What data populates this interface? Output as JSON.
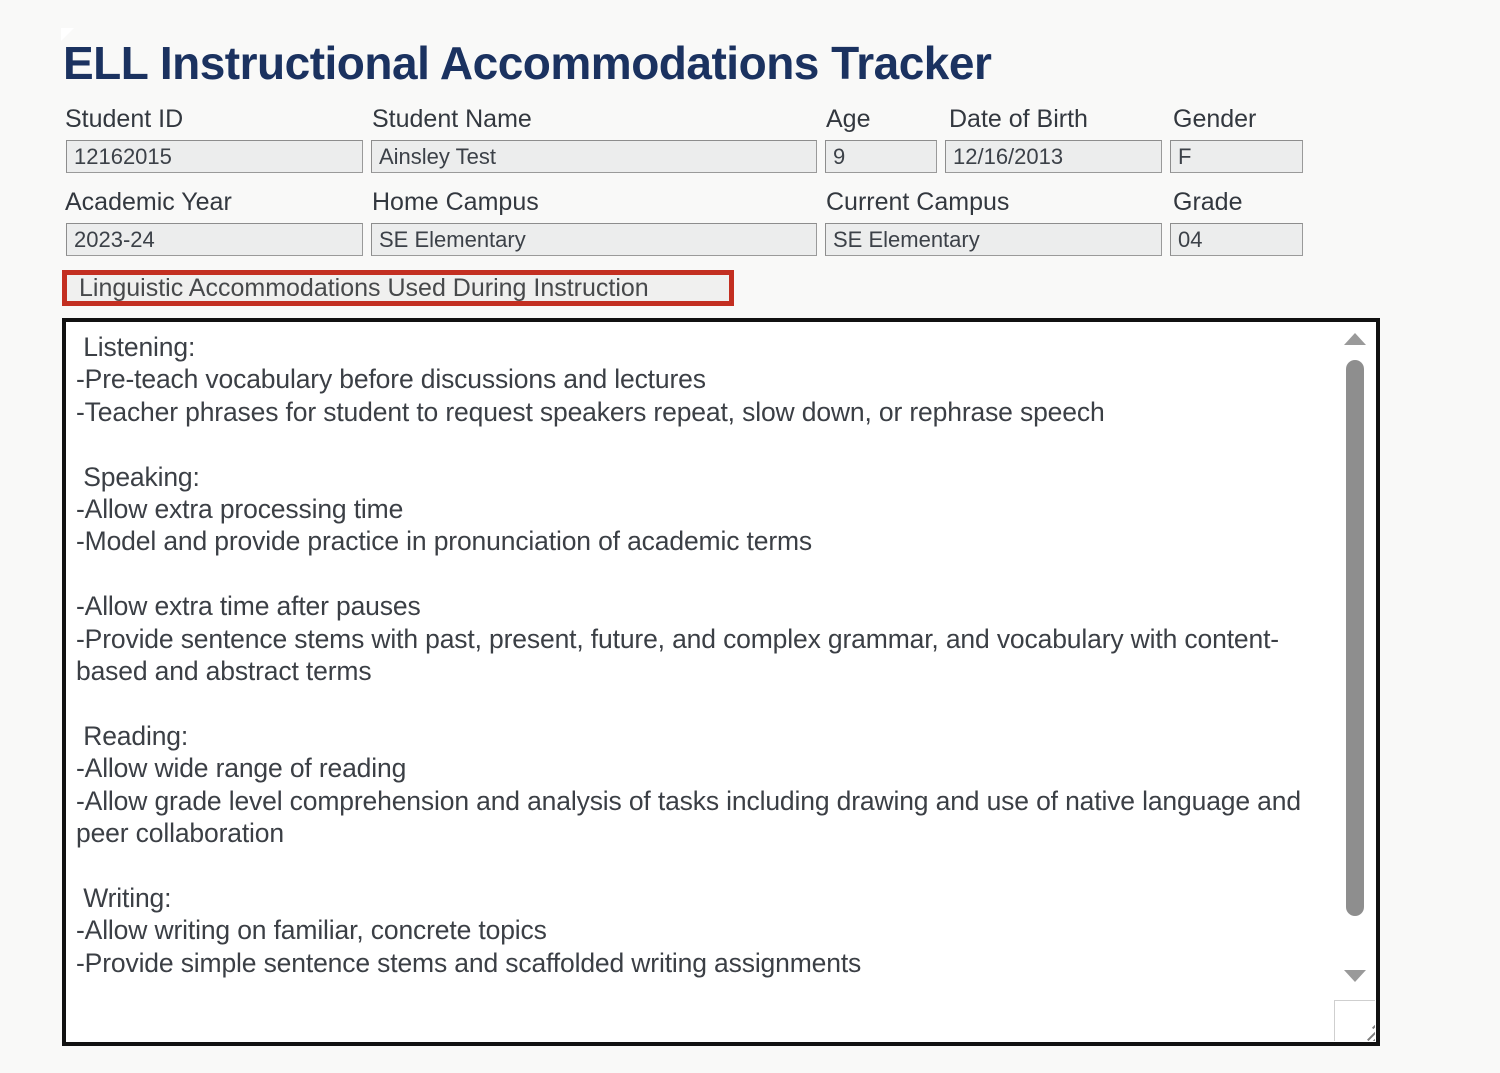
{
  "document": {
    "title": "ELL Instructional Accommodations Tracker",
    "accent_red": "#c32f21",
    "title_color": "#1b3260",
    "page_background": "#f9f9f8"
  },
  "student_info": {
    "fields": [
      {
        "label": "Student ID",
        "value": "12162015"
      },
      {
        "label": "Student Name",
        "value": "Ainsley Test"
      },
      {
        "label": "Age",
        "value": "9"
      },
      {
        "label": "Date of Birth",
        "value": "12/16/2013"
      },
      {
        "label": "Gender",
        "value": "F"
      },
      {
        "label": "Academic Year",
        "value": "2023-24"
      },
      {
        "label": "Home Campus",
        "value": "SE Elementary"
      },
      {
        "label": "Current Campus",
        "value": "SE Elementary"
      },
      {
        "label": "Grade",
        "value": "04"
      }
    ]
  },
  "section": {
    "header": "Linguistic Accommodations Used During Instruction"
  },
  "accommodations": {
    "lines": [
      " Listening:",
      "-Pre-teach vocabulary before discussions and lectures",
      "-Teacher phrases for student to request speakers repeat, slow down, or rephrase speech",
      "",
      " Speaking:",
      "-Allow extra processing time",
      "-Model and provide practice in pronunciation of academic terms",
      "",
      "-Allow extra time after pauses",
      "-Provide sentence stems with past, present, future, and complex grammar, and vocabulary with content-based and abstract terms",
      "",
      " Reading:",
      "-Allow wide range of reading",
      "-Allow grade level comprehension and analysis of tasks including drawing and use of native language and peer collaboration",
      "",
      " Writing:",
      "-Allow writing on familiar, concrete topics",
      "-Provide simple sentence stems and scaffolded writing assignments"
    ]
  },
  "scrollbar": {
    "up_arrow": "triangle-up-icon",
    "down_arrow": "triangle-down-icon",
    "thumb": "scrollbar-thumb"
  }
}
